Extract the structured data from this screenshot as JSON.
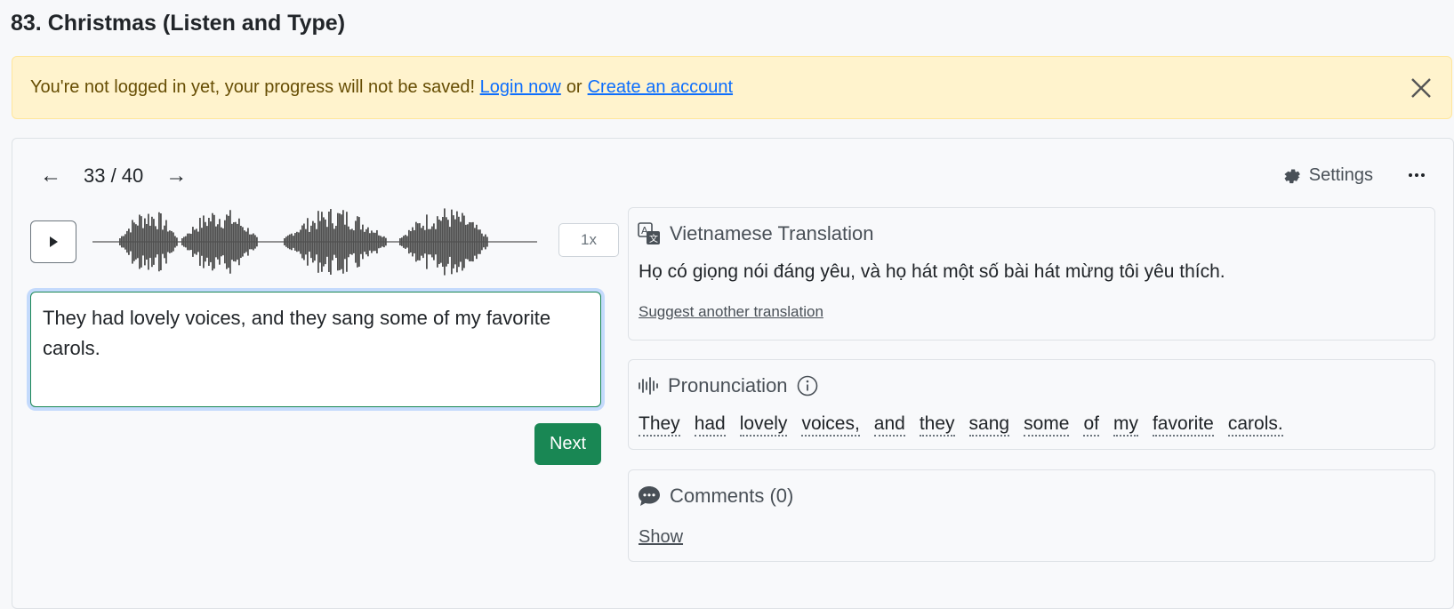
{
  "page": {
    "title": "83. Christmas (Listen and Type)"
  },
  "alert": {
    "message": "You're not logged in yet, your progress will not be saved!",
    "login_link": "Login now",
    "separator": "or",
    "signup_link": "Create an account",
    "close_icon": "close-icon"
  },
  "nav": {
    "prev_arrow": "←",
    "counter": "33 / 40",
    "next_arrow": "→",
    "settings_label": "Settings"
  },
  "player": {
    "speed": "1x",
    "play_icon": "play-icon"
  },
  "answer": {
    "value": "They had lovely voices, and they sang some of my favorite carols."
  },
  "next_button": "Next",
  "translation": {
    "title": "Vietnamese Translation",
    "text": "Họ có giọng nói đáng yêu, và họ hát một số bài hát mừng tôi yêu thích.",
    "suggest": "Suggest another translation"
  },
  "pronunciation": {
    "title": "Pronunciation",
    "words": [
      "They",
      "had",
      "lovely",
      "voices,",
      "and",
      "they",
      "sang",
      "some",
      "of",
      "my",
      "favorite",
      "carols."
    ]
  },
  "comments": {
    "title": "Comments (0)",
    "show": "Show"
  },
  "colors": {
    "success": "#198754",
    "link": "#0d6efd",
    "alert_bg": "#fff3cd"
  }
}
